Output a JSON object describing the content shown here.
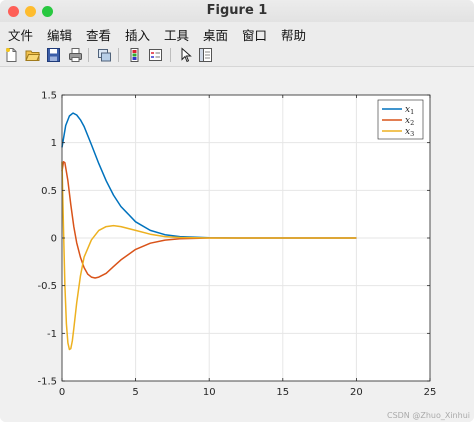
{
  "window": {
    "title": "Figure 1"
  },
  "menu": [
    "文件",
    "编辑",
    "查看",
    "插入",
    "工具",
    "桌面",
    "窗口",
    "帮助"
  ],
  "toolbar": [
    "new-figure-icon",
    "open-file-icon",
    "save-icon",
    "print-icon",
    "link-plot-icon",
    "insert-colorbar-icon",
    "insert-legend-icon",
    "edit-plot-icon",
    "property-inspector-icon"
  ],
  "watermark": "CSDN @Zhuo_Xinhui",
  "chart_data": {
    "type": "line",
    "xlim": [
      0,
      25
    ],
    "ylim": [
      -1.5,
      1.5
    ],
    "xticks": [
      "0",
      "5",
      "10",
      "15",
      "20",
      "25"
    ],
    "yticks": [
      "-1.5",
      "-1",
      "-0.5",
      "0",
      "0.5",
      "1",
      "1.5"
    ],
    "grid": true,
    "legend": "top-right",
    "series": [
      {
        "name": "x1",
        "color": "#0072bd",
        "x": [
          0,
          0.25,
          0.5,
          0.75,
          1,
          1.25,
          1.5,
          2,
          2.5,
          3,
          3.5,
          4,
          5,
          6,
          7,
          8,
          10,
          12,
          15,
          20
        ],
        "y": [
          0.95,
          1.18,
          1.28,
          1.31,
          1.29,
          1.24,
          1.17,
          0.98,
          0.78,
          0.6,
          0.45,
          0.33,
          0.17,
          0.08,
          0.035,
          0.015,
          0.002,
          0,
          0,
          0
        ]
      },
      {
        "name": "x2",
        "color": "#d95319",
        "x": [
          0,
          0.1,
          0.2,
          0.4,
          0.6,
          0.8,
          1,
          1.25,
          1.5,
          1.75,
          2,
          2.25,
          2.5,
          3,
          3.5,
          4,
          5,
          6,
          7,
          8,
          10,
          12,
          15,
          20
        ],
        "y": [
          0.7,
          0.8,
          0.79,
          0.6,
          0.35,
          0.12,
          -0.05,
          -0.2,
          -0.31,
          -0.38,
          -0.41,
          -0.42,
          -0.41,
          -0.37,
          -0.3,
          -0.23,
          -0.12,
          -0.055,
          -0.022,
          -0.008,
          0,
          0,
          0,
          0
        ]
      },
      {
        "name": "x3",
        "color": "#edb120",
        "x": [
          0,
          0.1,
          0.2,
          0.3,
          0.4,
          0.5,
          0.6,
          0.7,
          0.8,
          0.9,
          1,
          1.25,
          1.5,
          2,
          2.5,
          3,
          3.5,
          4,
          5,
          6,
          7,
          8,
          10,
          12,
          15,
          20
        ],
        "y": [
          0.8,
          0.1,
          -0.5,
          -0.9,
          -1.1,
          -1.17,
          -1.16,
          -1.08,
          -0.95,
          -0.82,
          -0.68,
          -0.4,
          -0.2,
          -0.02,
          0.08,
          0.12,
          0.13,
          0.12,
          0.08,
          0.04,
          0.015,
          0.005,
          0,
          0,
          0,
          0
        ]
      }
    ]
  }
}
